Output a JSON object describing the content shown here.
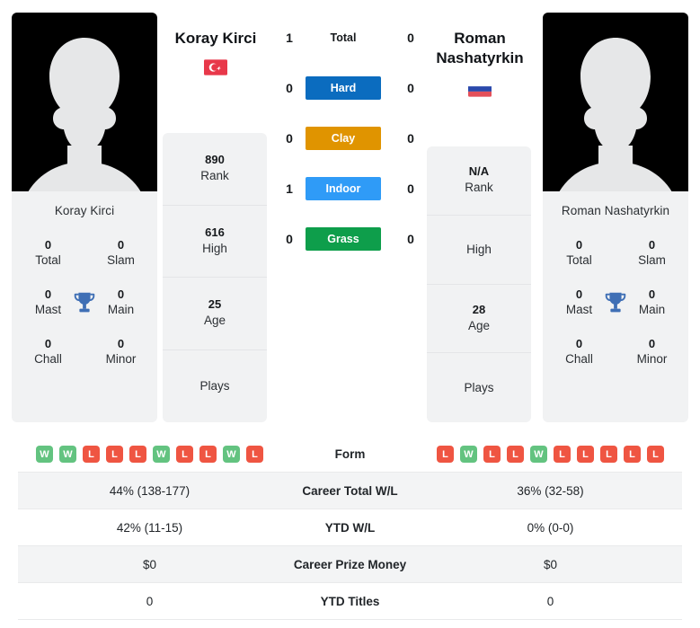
{
  "players": {
    "left": {
      "name": "Koray Kirci",
      "name_line1": "Koray Kirci",
      "card_name": "Koray Kirci",
      "country": "Turkey",
      "flag": "turkey-flag",
      "titles": [
        {
          "num": "0",
          "label": "Total"
        },
        {
          "num": "0",
          "label": "Slam"
        },
        {
          "num": "0",
          "label": "Mast"
        },
        {
          "num": "0",
          "label": "Main"
        },
        {
          "num": "0",
          "label": "Chall"
        },
        {
          "num": "0",
          "label": "Minor"
        }
      ],
      "summary": [
        {
          "num": "890",
          "label": "Rank"
        },
        {
          "num": "616",
          "label": "High"
        },
        {
          "num": "25",
          "label": "Age"
        },
        {
          "num": "",
          "label": "Plays"
        }
      ],
      "form": [
        "W",
        "W",
        "L",
        "L",
        "L",
        "W",
        "L",
        "L",
        "W",
        "L"
      ]
    },
    "right": {
      "name": "Roman Nashatyrkin",
      "name_line1": "Roman",
      "name_line2": "Nashatyrkin",
      "card_name": "Roman Nashatyrkin",
      "country": "Russia",
      "flag": "russia-flag",
      "titles": [
        {
          "num": "0",
          "label": "Total"
        },
        {
          "num": "0",
          "label": "Slam"
        },
        {
          "num": "0",
          "label": "Mast"
        },
        {
          "num": "0",
          "label": "Main"
        },
        {
          "num": "0",
          "label": "Chall"
        },
        {
          "num": "0",
          "label": "Minor"
        }
      ],
      "summary": [
        {
          "num": "N/A",
          "label": "Rank"
        },
        {
          "num": "",
          "label": "High"
        },
        {
          "num": "28",
          "label": "Age"
        },
        {
          "num": "",
          "label": "Plays"
        }
      ],
      "form": [
        "L",
        "W",
        "L",
        "L",
        "W",
        "L",
        "L",
        "L",
        "L",
        "L"
      ]
    }
  },
  "h2h": [
    {
      "label": "Total",
      "left": "1",
      "right": "0",
      "style": "plain",
      "color": ""
    },
    {
      "label": "Hard",
      "left": "0",
      "right": "0",
      "style": "badge",
      "color": "#0b6cbf"
    },
    {
      "label": "Clay",
      "left": "0",
      "right": "0",
      "style": "badge",
      "color": "#e09400"
    },
    {
      "label": "Indoor",
      "left": "1",
      "right": "0",
      "style": "badge",
      "color": "#2f9bf7"
    },
    {
      "label": "Grass",
      "left": "0",
      "right": "0",
      "style": "badge",
      "color": "#0e9e4b"
    }
  ],
  "stats_table": [
    {
      "label": "Form",
      "left": "",
      "right": "",
      "type": "form"
    },
    {
      "label": "Career Total W/L",
      "left": "44% (138-177)",
      "right": "36% (32-58)",
      "type": "text"
    },
    {
      "label": "YTD W/L",
      "left": "42% (11-15)",
      "right": "0% (0-0)",
      "type": "text"
    },
    {
      "label": "Career Prize Money",
      "left": "$0",
      "right": "$0",
      "type": "text"
    },
    {
      "label": "YTD Titles",
      "left": "0",
      "right": "0",
      "type": "text"
    }
  ],
  "colors": {
    "win": "#63c380",
    "loss": "#ef5542",
    "hard": "#0b6cbf",
    "clay": "#e09400",
    "indoor": "#2f9bf7",
    "grass": "#0e9e4b",
    "panel_bg": "#f1f2f3",
    "trophy": "#3f6fb5"
  }
}
